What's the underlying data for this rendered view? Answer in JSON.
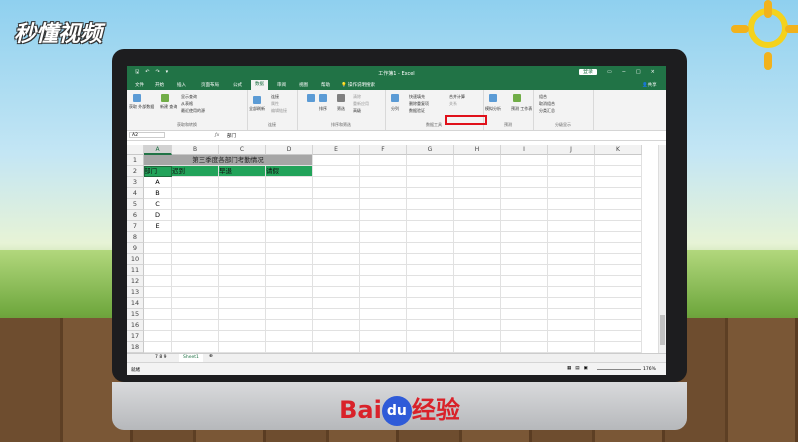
{
  "watermark_top": "秒懂视频",
  "brand_bottom": {
    "text1": "Bai",
    "du": "du",
    "text2": "经验"
  },
  "excel": {
    "title": "工作簿1 - Excel",
    "login": "登录",
    "share": "共享",
    "tabs": [
      "文件",
      "开始",
      "插入",
      "页面布局",
      "公式",
      "数据",
      "审阅",
      "视图",
      "帮助",
      "操作说明搜索"
    ],
    "active_tab": "数据",
    "ribbon": {
      "get_external": "获取\n外部数据",
      "new_query": "新建\n查询",
      "show_query": "显示查询",
      "from_table": "从表格",
      "recent_sources": "最近使用的源",
      "group_get": "获取和转换",
      "refresh_all": "全部刷新",
      "connections": "连接",
      "properties": "属性",
      "edit_links": "编辑链接",
      "group_conn": "连接",
      "sort": "排序",
      "filter": "筛选",
      "clear": "清除",
      "reapply": "重新应用",
      "advanced": "高级",
      "group_sort": "排序和筛选",
      "split": "分列",
      "flash_fill": "快速填充",
      "remove_dup": "删除重复项",
      "validation": "数据验证",
      "consolidate": "合并计算",
      "relations": "关系",
      "group_tools": "数据工具",
      "what_if": "模拟分析",
      "forecast": "预测\n工作表",
      "group_forecast": "预测",
      "group": "组合",
      "ungroup": "取消组合",
      "subtotal": "分类汇总",
      "group_outline": "分级显示"
    },
    "name_box": "A2",
    "formula_value": "部门",
    "columns": [
      "A",
      "B",
      "C",
      "D",
      "E",
      "F",
      "G",
      "H",
      "I",
      "J",
      "K"
    ],
    "rows": [
      "1",
      "2",
      "3",
      "4",
      "5",
      "6",
      "7",
      "8",
      "9",
      "10",
      "11",
      "12",
      "13",
      "14",
      "15",
      "16",
      "17",
      "18"
    ],
    "sheet_title": "第三季度各部门考勤情况",
    "headers": [
      "部门",
      "迟到",
      "早退",
      "请假"
    ],
    "departments": [
      "A",
      "B",
      "C",
      "D",
      "E"
    ],
    "sheet_nav": [
      "7",
      "8",
      "9"
    ],
    "sheet_tab": "Sheet1",
    "status_ready": "就绪",
    "zoom": "176%"
  },
  "colors": {
    "excel_green": "#217346",
    "header_green": "#22a35a",
    "highlight": "#e0101a"
  }
}
